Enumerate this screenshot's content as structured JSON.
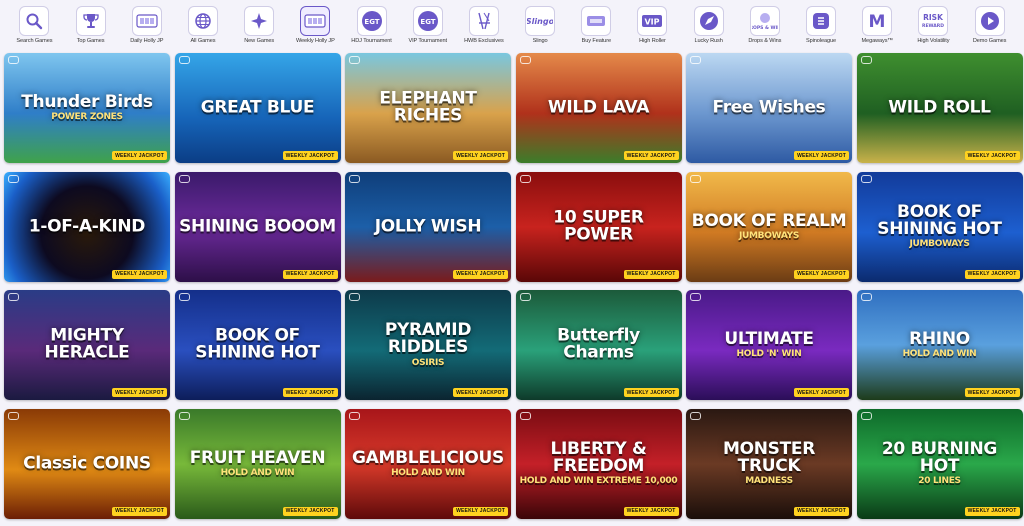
{
  "categories": [
    {
      "label": "Search Games",
      "icon": "search-icon",
      "active": false
    },
    {
      "label": "Top Games",
      "icon": "trophy-icon",
      "active": false
    },
    {
      "label": "Daily Holly JP",
      "icon": "jackpot-icon",
      "active": false
    },
    {
      "label": "All Games",
      "icon": "globe-icon",
      "active": false
    },
    {
      "label": "New Games",
      "icon": "star-burst-icon",
      "active": false
    },
    {
      "label": "Weekly Holly JP",
      "icon": "jackpot-icon",
      "active": true
    },
    {
      "label": "HDJ Tournament",
      "icon": "egt-logo-icon",
      "active": false
    },
    {
      "label": "VIP Tournament",
      "icon": "egt-logo-icon",
      "active": false
    },
    {
      "label": "HWB Exclusives",
      "icon": "chair-icon",
      "active": false
    },
    {
      "label": "Slingo",
      "icon": "slingo-logo-icon",
      "active": false
    },
    {
      "label": "Buy Feature",
      "icon": "ticket-icon",
      "active": false
    },
    {
      "label": "High Roller",
      "icon": "vip-icon",
      "active": false
    },
    {
      "label": "Lucky Rush",
      "icon": "rocket-icon",
      "active": false
    },
    {
      "label": "Drops & Wins",
      "icon": "drops-wins-icon",
      "active": false
    },
    {
      "label": "Spinoleague",
      "icon": "spinoleague-icon",
      "active": false
    },
    {
      "label": "Megaways™",
      "icon": "megaways-icon",
      "active": false
    },
    {
      "label": "High Volatility",
      "icon": "risk-reward-icon",
      "active": false
    },
    {
      "label": "Demo Games",
      "icon": "play-icon",
      "active": false
    }
  ],
  "icon_texts": {
    "megaways": "M",
    "vip": "VIP",
    "egt": "EGT",
    "risk": "RISK",
    "reward": "REWARD",
    "slingo": "Slingo",
    "drops": "DROPS & WINS"
  },
  "badge_text": "WEEKLY JACKPOT",
  "games": [
    {
      "title": "Thunder Birds",
      "sub": "POWER ZONES",
      "bg": "linear-gradient(180deg,#7fc6ef,#2f7ec8 55%,#3fa24a)"
    },
    {
      "title": "GREAT BLUE",
      "sub": "",
      "bg": "linear-gradient(180deg,#35a6e8,#1664b8 60%,#0b3d85)"
    },
    {
      "title": "ELEPHANT RICHES",
      "sub": "",
      "bg": "linear-gradient(180deg,#79c7df,#d9a24b 55%,#8b5a22)"
    },
    {
      "title": "WILD LAVA",
      "sub": "",
      "bg": "linear-gradient(180deg,#e58a4a,#b0311b 55%,#3b7d2a)"
    },
    {
      "title": "Free Wishes",
      "sub": "",
      "bg": "linear-gradient(180deg,#bcd8f2,#6c97cf 55%,#2e5aa3)"
    },
    {
      "title": "WILD ROLL",
      "sub": "",
      "bg": "linear-gradient(180deg,#3f8f2f,#1f5f22 55%,#c9b24a)"
    },
    {
      "title": "1-OF-A-KIND",
      "sub": "",
      "bg": "radial-gradient(circle at 50% 55%,#2a1a0a 0%,#0d0a20 45%,#1a5fc8 80%,#3ab0ff)"
    },
    {
      "title": "SHINING BOOOM",
      "sub": "",
      "bg": "linear-gradient(180deg,#3a1a6a,#6b2a9a 50%,#2d0f48)"
    },
    {
      "title": "JOLLY WISH",
      "sub": "",
      "bg": "linear-gradient(180deg,#0f3e7a,#1c5fa8 50%,#7a1b1b)"
    },
    {
      "title": "10 SUPER POWER",
      "sub": "",
      "bg": "linear-gradient(180deg,#8a0e0e,#c8231e 50%,#5a0707)"
    },
    {
      "title": "BOOK OF REALM",
      "sub": "JUMBOWAYS",
      "bg": "linear-gradient(180deg,#f1b94a,#d07a23 55%,#6b3c14)"
    },
    {
      "title": "BOOK OF SHINING HOT",
      "sub": "JUMBOWAYS",
      "bg": "linear-gradient(180deg,#123b9a,#1d5fd0 55%,#0b2a6e)"
    },
    {
      "title": "MIGHTY HERACLE",
      "sub": "",
      "bg": "linear-gradient(180deg,#2a3c86,#5a2a7a 55%,#1b1a40)"
    },
    {
      "title": "BOOK OF SHINING HOT",
      "sub": "",
      "bg": "linear-gradient(180deg,#142f8a,#2a4fbf 55%,#0d1e5a)"
    },
    {
      "title": "PYRAMID RIDDLES",
      "sub": "OSIRIS",
      "bg": "linear-gradient(180deg,#0d3a4a,#136b77 55%,#0b2430)"
    },
    {
      "title": "Butterfly Charms",
      "sub": "",
      "bg": "linear-gradient(180deg,#1c5a3a,#2aa17a 55%,#0e3a2a)"
    },
    {
      "title": "ULTIMATE",
      "sub": "HOLD 'N' WIN",
      "bg": "linear-gradient(180deg,#4a1a88,#7a2ac0 55%,#2b0e58)"
    },
    {
      "title": "RHINO",
      "sub": "HOLD AND WIN",
      "bg": "linear-gradient(180deg,#2f6fc0,#5aa0de 50%,#1d3b1a)"
    },
    {
      "title": "Classic COINS",
      "sub": "",
      "bg": "linear-gradient(180deg,#8a3a06,#e08a14 55%,#6b1e05)"
    },
    {
      "title": "FRUIT HEAVEN",
      "sub": "HOLD AND WIN",
      "bg": "linear-gradient(180deg,#3a7a2a,#78b93a 50%,#2a5a1a)"
    },
    {
      "title": "GAMBLELICIOUS",
      "sub": "HOLD AND WIN",
      "bg": "linear-gradient(180deg,#a8161a,#d83a2a 50%,#5e0a0a)"
    },
    {
      "title": "LIBERTY & FREEDOM",
      "sub": "HOLD AND WIN EXTREME 10,000",
      "bg": "linear-gradient(180deg,#7a0c12,#c42028 50%,#3a0508)"
    },
    {
      "title": "MONSTER TRUCK",
      "sub": "MADNESS",
      "bg": "linear-gradient(180deg,#2a1812,#6b3a24 50%,#1a0e0a)"
    },
    {
      "title": "20 BURNING HOT",
      "sub": "20 LINES",
      "bg": "linear-gradient(180deg,#0e6a2a,#2aa84a 50%,#0a3a16)"
    }
  ]
}
